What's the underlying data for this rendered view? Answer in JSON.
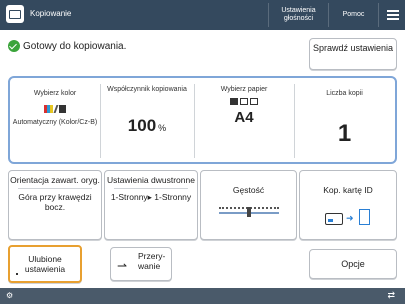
{
  "header": {
    "title": "Kopiowanie",
    "counter_label": "Ustawienia głośności",
    "help_label": "Pomoc",
    "menu_icon": "hamburger-menu-icon",
    "home_icon": "home-icon"
  },
  "status": {
    "icon": "ready-check-icon",
    "text": "Gotowy do kopiowania.",
    "check_settings_label": "Sprawdź ustawienia"
  },
  "settings": {
    "color": {
      "label": "Wybierz kolor",
      "value": "Automatyczny (Kolor/Cz-B)"
    },
    "ratio": {
      "label": "Współczynnik kopiowania",
      "value": "100",
      "unit": "%"
    },
    "paper": {
      "label": "Wybierz papier",
      "value": "A4"
    },
    "copies": {
      "label": "Liczba kopii",
      "value": "1"
    }
  },
  "functions": {
    "orientation": {
      "label": "Orientacja zawart. oryg.",
      "value": "Góra przy krawędzi bocz."
    },
    "duplex": {
      "label": "Ustawienia dwustronne",
      "value": "1-Stronny▸ 1-Stronny"
    },
    "density": {
      "label": "Gęstość",
      "level": 0.5
    },
    "id_card": {
      "label": "Kop. kartę ID"
    }
  },
  "bottom": {
    "favorites_label": "Ulubione ustawienia",
    "interrupt_label": "Przery- wanie",
    "options_label": "Opcje"
  },
  "accent_colors": {
    "panel_border": "#7fa6d8",
    "highlight": "#e8a030",
    "header_bg": "#34495e"
  }
}
